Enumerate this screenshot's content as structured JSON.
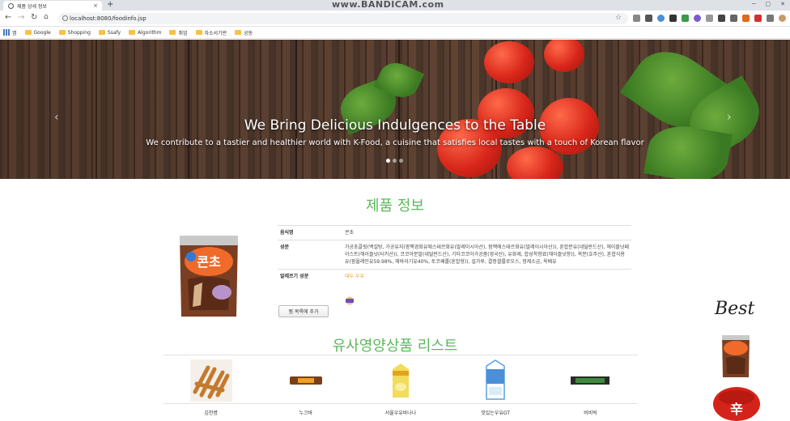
{
  "browser": {
    "tab_title": "제품 상세 정보",
    "tab_close": "×",
    "new_tab": "+",
    "watermark": "www.BANDICAM.com",
    "url": "localhost:8080/foodinfo.jsp",
    "bookmarks": [
      {
        "label": "앱"
      },
      {
        "label": "Google"
      },
      {
        "label": "Shopping"
      },
      {
        "label": "Ssafy"
      },
      {
        "label": "Algorithm"
      },
      {
        "label": "취업"
      },
      {
        "label": "자소서기반"
      },
      {
        "label": "공동"
      }
    ]
  },
  "hero": {
    "title": "We Bring Delicious Indulgences to the Table",
    "subtitle": "We contribute to a tastier and healthier world with K-Food, a cuisine that satisfies local tastes with a touch of Korean flavor",
    "prev": "‹",
    "next": "›",
    "slide_count": 3,
    "active_slide": 0
  },
  "product": {
    "section_title": "제품 정보",
    "rows": [
      {
        "key": "음식명",
        "value": "콘초"
      },
      {
        "key": "성분",
        "value": "가공초콜릿(백설탕, 가공유지(팜핵경화유에스테르화유(말레이시아산), 팜핵에스테르화유(말레이시아산)), 혼합분유(네덜란드산), 헤이즐넛페이스트(헤이즐넛(터키산)), 코코아분말(네덜란드산), 기타코코아가공품(영국산), 유화제, 합성착향료(헤이즐넛향)), 옥분(호주산), 혼합식용유(팜올레인유59.98%, 해바라기유40%, 토코페롤(혼합형)), 설가루, 결정셀룰로오스, 정제소금, 옥배유"
      },
      {
        "key": "알레르기 성분",
        "value": "대두 우유"
      }
    ],
    "cart_button": "찜 목록에 추가"
  },
  "similar": {
    "section_title": "유사영양상품 리스트",
    "items": [
      {
        "name": "김천병"
      },
      {
        "name": "누크바"
      },
      {
        "name": "서울우유바나나"
      },
      {
        "name": "맛있는우유GT"
      },
      {
        "name": "비비빅"
      }
    ]
  },
  "best": {
    "label": "Best"
  }
}
